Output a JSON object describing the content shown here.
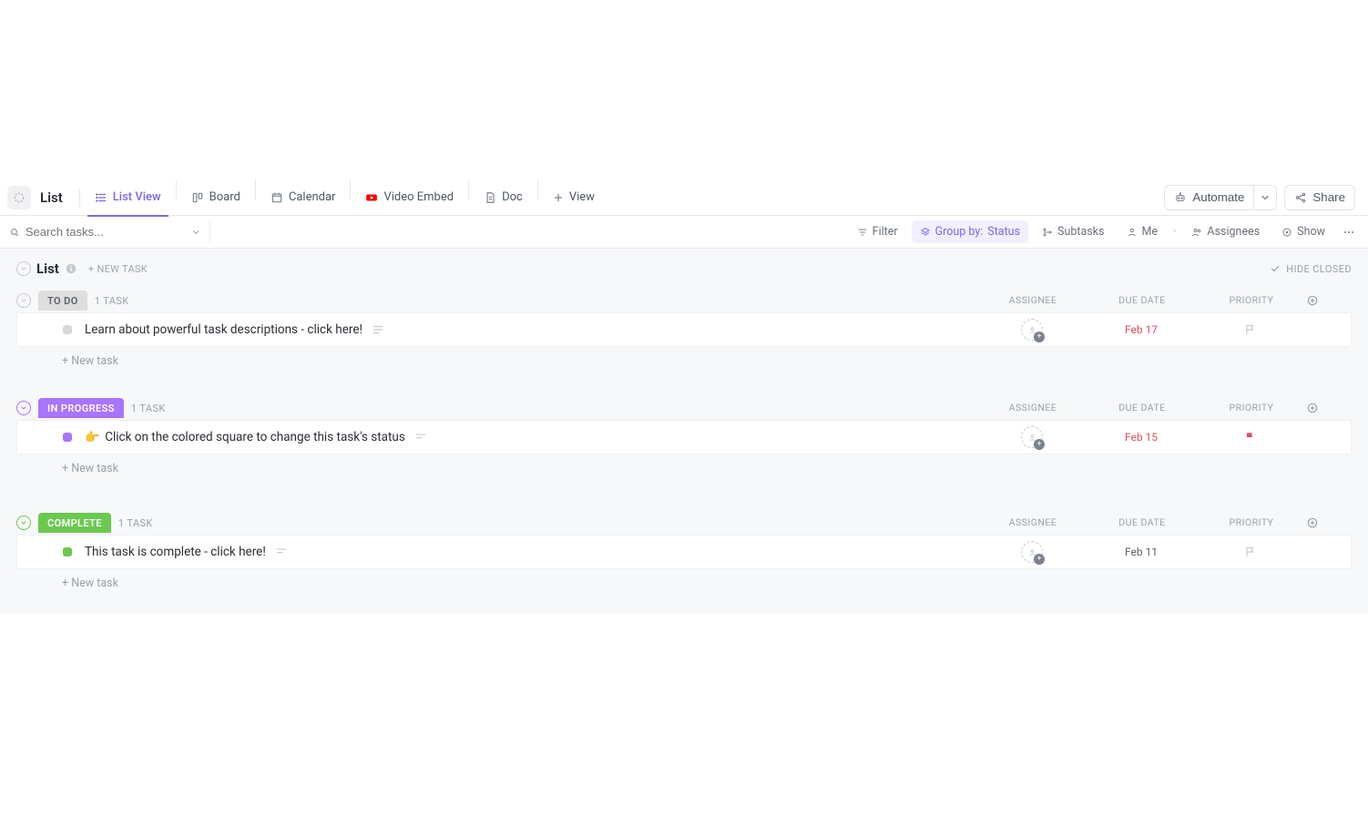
{
  "page": {
    "title": "List"
  },
  "tabs": {
    "list": "List View",
    "board": "Board",
    "calendar": "Calendar",
    "video": "Video Embed",
    "doc": "Doc",
    "add": "View"
  },
  "header_actions": {
    "automate": "Automate",
    "share": "Share"
  },
  "search": {
    "placeholder": "Search tasks..."
  },
  "toolbar": {
    "filter": "Filter",
    "group_by_prefix": "Group by:",
    "group_by_value": "Status",
    "subtasks": "Subtasks",
    "me": "Me",
    "assignees": "Assignees",
    "show": "Show"
  },
  "list_header": {
    "title": "List",
    "new_task": "+ NEW TASK",
    "hide_closed": "HIDE CLOSED"
  },
  "columns": {
    "assignee": "ASSIGNEE",
    "due_date": "DUE DATE",
    "priority": "PRIORITY"
  },
  "new_task_row": "+ New task",
  "groups": [
    {
      "id": "todo",
      "label": "TO DO",
      "count_label": "1 TASK",
      "tasks": [
        {
          "title": "Learn about powerful task descriptions - click here!",
          "due": "Feb 17",
          "due_style": "red",
          "priority": "none",
          "emoji": ""
        }
      ]
    },
    {
      "id": "inprogress",
      "label": "IN PROGRESS",
      "count_label": "1 TASK",
      "tasks": [
        {
          "title": "Click on the colored square to change this task's status",
          "due": "Feb 15",
          "due_style": "red",
          "priority": "urgent",
          "emoji": "👉"
        }
      ]
    },
    {
      "id": "complete",
      "label": "COMPLETE",
      "count_label": "1 TASK",
      "tasks": [
        {
          "title": "This task is complete - click here!",
          "due": "Feb 11",
          "due_style": "gray",
          "priority": "none",
          "emoji": ""
        }
      ]
    }
  ]
}
